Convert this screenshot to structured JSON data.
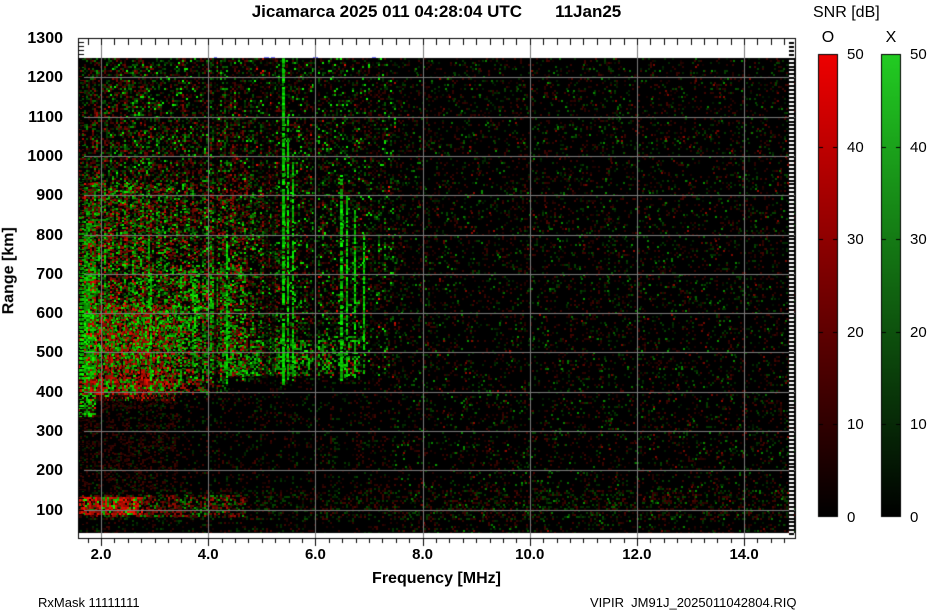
{
  "title": {
    "text": "Jicamarca 2025 011 04:28:04 UTC       11Jan25"
  },
  "footer": {
    "left": "RxMask 11111111",
    "right": "VIPIR  JM91J_2025011042804.RIQ"
  },
  "colorbar": {
    "title": "SNR [dB]",
    "o_label": "O",
    "x_label": "X",
    "ticks": [
      "50",
      "40",
      "30",
      "20",
      "10",
      "0"
    ],
    "tick_values": [
      50,
      40,
      30,
      20,
      10,
      0
    ],
    "dash_values": [
      40,
      30,
      20,
      10
    ],
    "min": 0,
    "max": 50,
    "o_top_color": "#ee0000",
    "x_top_color": "#22cc22",
    "bottom_color": "#000000"
  },
  "chart_data": {
    "type": "heatmap",
    "title": "Jicamarca 2025 011 04:28:04 UTC 11Jan25",
    "xlabel": "Frequency [MHz]",
    "ylabel": "Range [km]",
    "x_range": [
      1.57,
      14.95
    ],
    "y_range": [
      28,
      1300
    ],
    "x_ticks": [
      2,
      4,
      6,
      8,
      10,
      12,
      14
    ],
    "x_tick_labels": [
      "2.0",
      "4.0",
      "6.0",
      "8.0",
      "10.0",
      "12.0",
      "14.0"
    ],
    "y_ticks": [
      100,
      200,
      300,
      400,
      500,
      600,
      700,
      800,
      900,
      1000,
      1100,
      1200,
      1300
    ],
    "grid": true,
    "legend": "colorbars O (red) and X (green), SNR 0-50 dB",
    "colorbar": {
      "label": "SNR [dB]",
      "min": 0,
      "max": 50,
      "series": [
        {
          "name": "O",
          "color": "#ee0000"
        },
        {
          "name": "X",
          "color": "#22cc22"
        }
      ]
    },
    "data_extent": {
      "f": [
        1.57,
        14.95
      ],
      "r": [
        40,
        1250
      ]
    },
    "layout": {
      "grid_color": "#7a7a7a",
      "frame_color": "#000000",
      "background": "#ffffff",
      "plot_background": "#000000"
    },
    "texture": {
      "seed": 42,
      "cell": 2,
      "regions": [
        {
          "name": "base-noise",
          "f": [
            1.57,
            14.95
          ],
          "r": [
            41,
            1249
          ],
          "density": 0.2,
          "red": 0.58,
          "bright": [
            25,
            75
          ],
          "streak": 0.6
        },
        {
          "name": "left-field",
          "f": [
            1.57,
            8.3
          ],
          "r": [
            420,
            1249
          ],
          "density": 0.3,
          "red": 0.52,
          "bright": [
            40,
            120
          ],
          "streak": 0.8,
          "fadeR": [
            3.5,
            0.25
          ]
        },
        {
          "name": "active-f-region",
          "f": [
            1.57,
            7.45
          ],
          "r": [
            450,
            1249
          ],
          "density": 0.5,
          "red": 0.5,
          "bright": [
            60,
            220
          ],
          "streak": 1,
          "fadeR": [
            2.5,
            0.3
          ],
          "fadeT": [
            800,
            0.45
          ]
        },
        {
          "name": "core-mix",
          "f": [
            1.65,
            5.3
          ],
          "r": [
            440,
            930
          ],
          "density": 0.6,
          "red": 0.5,
          "bright": [
            80,
            255
          ],
          "streak": 1,
          "fadeR": [
            2.2,
            0.35
          ]
        },
        {
          "name": "red-core",
          "f": [
            1.9,
            3.35
          ],
          "r": [
            380,
            620
          ],
          "density": 0.72,
          "red": 0.82,
          "bright": [
            110,
            255
          ],
          "streak": 0.8
        },
        {
          "name": "green-mid",
          "f": [
            3.3,
            4.7
          ],
          "r": [
            430,
            720
          ],
          "density": 0.5,
          "red": 0.25,
          "bright": [
            110,
            255
          ],
          "streak": 0.9
        },
        {
          "name": "green-core",
          "f": [
            1.6,
            3.4
          ],
          "r": [
            465,
            625
          ],
          "density": 0.45,
          "red": 0.25,
          "bright": [
            120,
            255
          ],
          "streak": 0.8
        },
        {
          "name": "left-green-strip",
          "f": [
            1.57,
            1.9
          ],
          "r": [
            340,
            950
          ],
          "density": 0.85,
          "red": 0.08,
          "bright": [
            110,
            255
          ],
          "fadeT": [
            620,
            0.25
          ]
        },
        {
          "name": "bottom-boundary-echo",
          "f": [
            1.57,
            4.3
          ],
          "r": [
            395,
            432
          ],
          "density": 0.85,
          "red": 0.62,
          "bright": [
            90,
            235
          ],
          "fadeR": [
            3.0,
            0.45
          ]
        },
        {
          "name": "green-bottom-cluster",
          "f": [
            4.3,
            6.8
          ],
          "r": [
            445,
            530
          ],
          "density": 0.55,
          "red": 0.2,
          "bright": [
            110,
            255
          ],
          "streak": 0.9
        },
        {
          "name": "sub-boundary-haze",
          "f": [
            1.57,
            3.4
          ],
          "r": [
            150,
            395
          ],
          "density": 0.28,
          "red": 0.8,
          "bright": [
            26,
            65
          ]
        },
        {
          "name": "e-region-band",
          "f": [
            1.57,
            14.95
          ],
          "r": [
            78,
            148
          ],
          "density": 0.22,
          "red": 0.55,
          "bright": [
            28,
            80
          ]
        },
        {
          "name": "e-region-left",
          "f": [
            1.57,
            4.7
          ],
          "r": [
            86,
            136
          ],
          "density": 0.5,
          "red": 0.68,
          "bright": [
            60,
            170
          ]
        },
        {
          "name": "e-region-red-blob",
          "f": [
            1.6,
            2.75
          ],
          "r": [
            90,
            132
          ],
          "density": 0.85,
          "red": 0.85,
          "bright": [
            120,
            255
          ]
        },
        {
          "name": "green-sparkles",
          "f": [
            2.1,
            7.5
          ],
          "r": [
            430,
            1249
          ],
          "density": 0.05,
          "red": 0.0,
          "bright": [
            150,
            255
          ]
        },
        {
          "name": "right-sparse",
          "f": [
            7.5,
            14.9
          ],
          "r": [
            41,
            1249
          ],
          "density": 0.03,
          "red": 0.2,
          "bright": [
            60,
            150
          ]
        }
      ],
      "green_streaks": [
        {
          "f": 5.38,
          "r": [
            420,
            1250
          ],
          "w": 3
        },
        {
          "f": 5.47,
          "r": [
            430,
            1100
          ],
          "w": 2
        },
        {
          "f": 5.56,
          "r": [
            430,
            980
          ],
          "w": 2
        },
        {
          "f": 6.45,
          "r": [
            430,
            950
          ],
          "w": 3
        },
        {
          "f": 6.58,
          "r": [
            440,
            900
          ],
          "w": 2
        },
        {
          "f": 6.72,
          "r": [
            440,
            860
          ],
          "w": 2
        },
        {
          "f": 6.88,
          "r": [
            450,
            800
          ],
          "w": 2
        },
        {
          "f": 4.33,
          "r": [
            420,
            780
          ],
          "w": 2
        },
        {
          "f": 2.92,
          "r": [
            400,
            700
          ],
          "w": 2
        }
      ],
      "dark_streaks": [
        {
          "f": 5.05,
          "w": 5
        },
        {
          "f": 5.18,
          "w": 4
        },
        {
          "f": 5.95,
          "w": 5
        },
        {
          "f": 7.05,
          "w": 4
        },
        {
          "f": 4.1,
          "w": 3
        }
      ]
    }
  }
}
